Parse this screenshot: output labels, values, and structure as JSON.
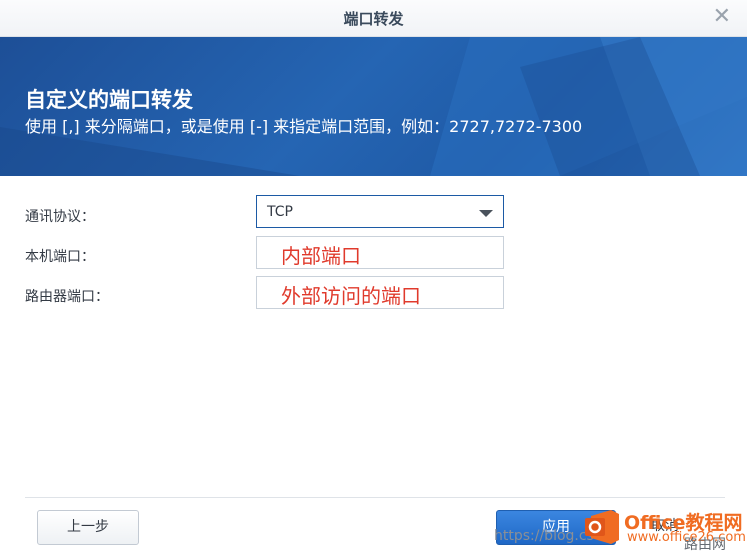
{
  "window": {
    "title": "端口转发",
    "close_glyph": "✕"
  },
  "banner": {
    "heading": "自定义的端口转发",
    "description": "使用 [,] 来分隔端口，或是使用 [-] 来指定端口范围，例如：2727,7272-7300"
  },
  "form": {
    "protocol": {
      "label": "通讯协议：",
      "value": "TCP"
    },
    "local_port": {
      "label": "本机端口：",
      "value": "内部端口"
    },
    "router_port": {
      "label": "路由器端口：",
      "value": "外部访问的端口"
    }
  },
  "buttons": {
    "prev": "上一步",
    "apply": "应用",
    "cancel": "取消"
  },
  "watermark": {
    "blog_url": "https://blog.cs",
    "logo_text": "Office教程网",
    "logo_url": "www.office26.com",
    "logo_tag": "路由网"
  },
  "colors": {
    "accent": "#1f68c6",
    "banner": "#1d4f97",
    "annotation": "#e03a2c"
  }
}
